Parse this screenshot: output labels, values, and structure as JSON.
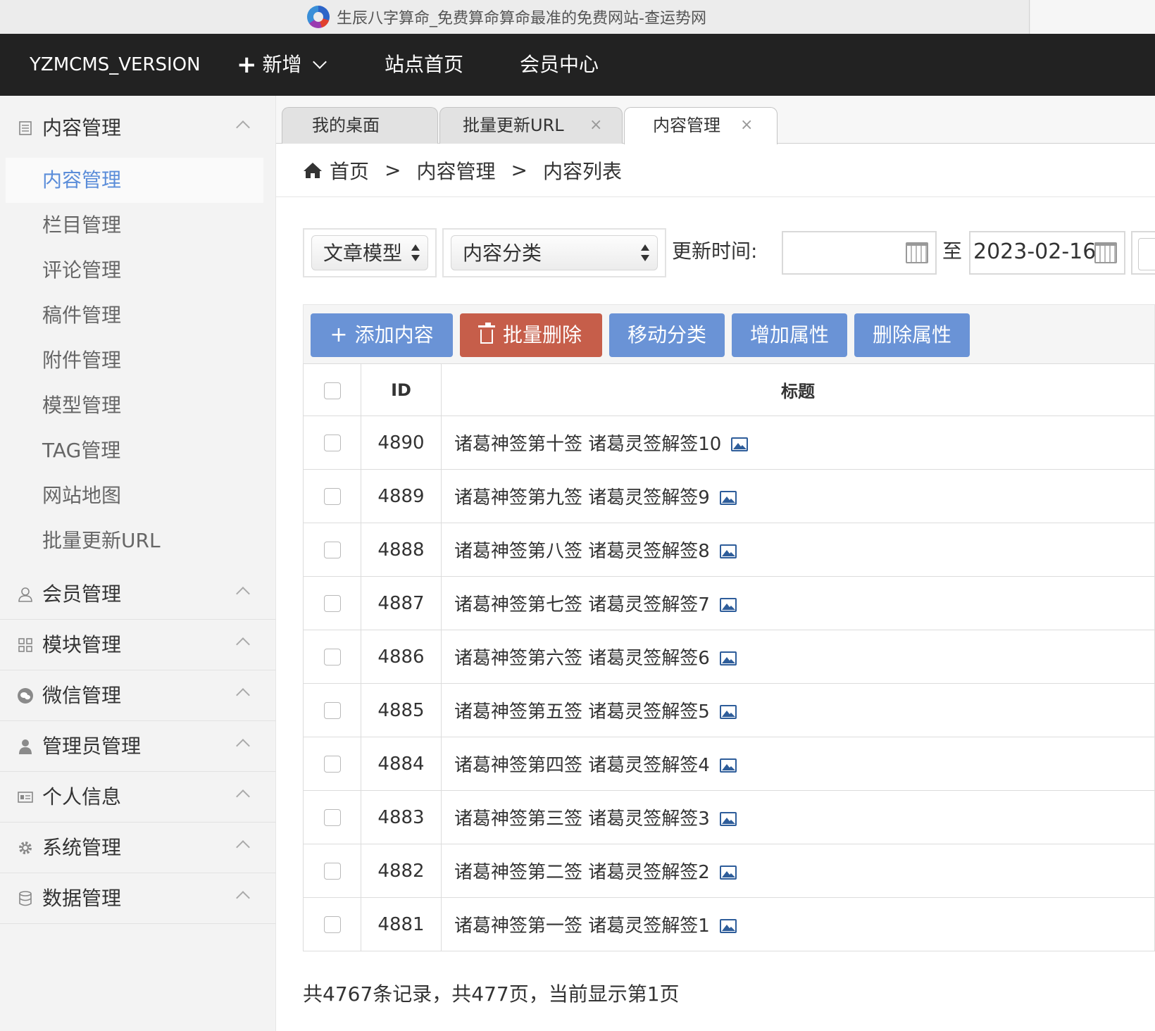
{
  "browser": {
    "title": "生辰八字算命_免费算命算命最准的免费网站-查运势网"
  },
  "topnav": {
    "brand": "YZMCMS_VERSION",
    "add_plus": "+",
    "add_label": "新增",
    "home_label": "站点首页",
    "member_label": "会员中心"
  },
  "sidebar": {
    "groups": [
      {
        "label": "内容管理",
        "icon": "document-icon"
      },
      {
        "label": "会员管理",
        "icon": "user-icon"
      },
      {
        "label": "模块管理",
        "icon": "grid-icon"
      },
      {
        "label": "微信管理",
        "icon": "wechat-icon"
      },
      {
        "label": "管理员管理",
        "icon": "admin-icon"
      },
      {
        "label": "个人信息",
        "icon": "id-card-icon"
      },
      {
        "label": "系统管理",
        "icon": "gear-icon"
      },
      {
        "label": "数据管理",
        "icon": "database-icon"
      }
    ],
    "content_items": [
      "内容管理",
      "栏目管理",
      "评论管理",
      "稿件管理",
      "附件管理",
      "模型管理",
      "TAG管理",
      "网站地图",
      "批量更新URL"
    ]
  },
  "tabs": [
    {
      "label": "我的桌面",
      "close": ""
    },
    {
      "label": "批量更新URL",
      "close": "×"
    },
    {
      "label": "内容管理",
      "close": "×"
    }
  ],
  "breadcrumb": {
    "home": "首页",
    "sep": ">",
    "level1": "内容管理",
    "level2": "内容列表"
  },
  "filters": {
    "model_selected": "文章模型",
    "category_selected": "内容分类",
    "update_time_label": "更新时间:",
    "date_from": "",
    "date_sep": "至",
    "date_to": "2023-02-16"
  },
  "toolbar": {
    "add_plus": "+",
    "add_label": "添加内容",
    "delete_label": "批量删除",
    "move_label": "移动分类",
    "add_attr_label": "增加属性",
    "del_attr_label": "删除属性"
  },
  "table": {
    "headers": {
      "id": "ID",
      "title": "标题"
    },
    "rows": [
      {
        "id": "4890",
        "title": "诸葛神签第十签 诸葛灵签解签10"
      },
      {
        "id": "4889",
        "title": "诸葛神签第九签 诸葛灵签解签9"
      },
      {
        "id": "4888",
        "title": "诸葛神签第八签 诸葛灵签解签8"
      },
      {
        "id": "4887",
        "title": "诸葛神签第七签 诸葛灵签解签7"
      },
      {
        "id": "4886",
        "title": "诸葛神签第六签 诸葛灵签解签6"
      },
      {
        "id": "4885",
        "title": "诸葛神签第五签 诸葛灵签解签5"
      },
      {
        "id": "4884",
        "title": "诸葛神签第四签 诸葛灵签解签4"
      },
      {
        "id": "4883",
        "title": "诸葛神签第三签 诸葛灵签解签3"
      },
      {
        "id": "4882",
        "title": "诸葛神签第二签 诸葛灵签解签2"
      },
      {
        "id": "4881",
        "title": "诸葛神签第一签 诸葛灵签解签1"
      }
    ]
  },
  "pagination": {
    "summary": "共4767条记录，共477页，当前显示第1页"
  },
  "colors": {
    "topnav_bg": "#222222",
    "active_link": "#5b8dd9",
    "primary_button": "#6a93d6",
    "danger_button": "#c65e4a",
    "image_icon": "#2e5d9a"
  }
}
